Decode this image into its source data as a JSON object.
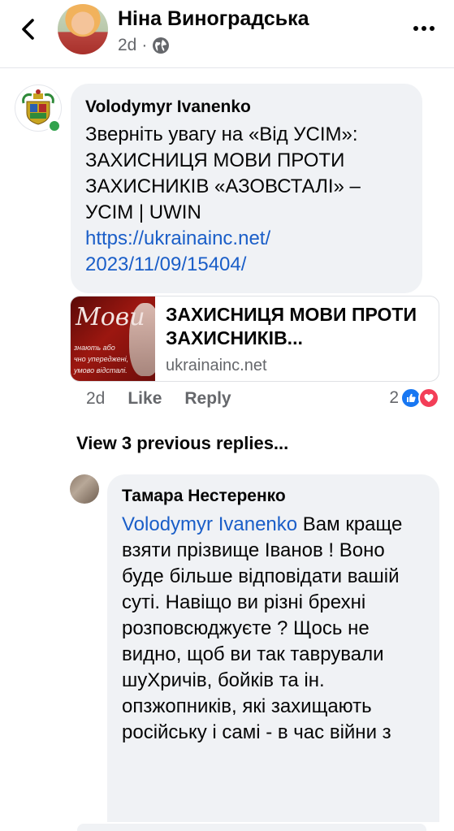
{
  "header": {
    "name": "Ніна Виноградська",
    "time": "2d",
    "separator": "·"
  },
  "comment1": {
    "author": "Volodymyr Ivanenko",
    "text": "Зверніть увагу на «Від УСІМ»: ЗАХИСНИЦЯ МОВИ ПРОТИ ЗАХИСНИКІВ «АЗОВСТАЛІ» – УСІМ | UWIN",
    "link": "https://ukrainainc.net/ 2023/11/09/15404/",
    "preview": {
      "title": "ЗАХИСНИЦЯ МОВИ ПРОТИ ЗАХИСНИКІВ...",
      "domain": "ukrainainc.net",
      "image_word": "Мови",
      "image_line1": "знають або",
      "image_line2": "чно упереджені,",
      "image_line3": "умово відсталі."
    },
    "time": "2d",
    "like_label": "Like",
    "reply_label": "Reply",
    "reaction_count": "2"
  },
  "view_previous": "View 3 previous replies...",
  "comment2": {
    "author": "Тамара Нестеренко",
    "mention": "Volodymyr Ivanenko",
    "text": " Вам краще взяти прізвище Іванов ! Воно буде більше відповідати вашій суті. Навіщо ви різні брехні розповсюджуєте ? Щось не видно, щоб ви так таврували шуХричів, бойків та ін. опзжопників, які захищають російську і самі - в час війни з"
  },
  "colors": {
    "link": "#1a5ec8",
    "bubble": "#f0f2f5",
    "online": "#31a24c",
    "like": "#1877f2",
    "love": "#f33e58"
  },
  "icons": {
    "back": "chevron-left-icon",
    "more": "more-dots-icon",
    "audience": "globe-icon",
    "like_reaction": "thumbs-up-icon",
    "love_reaction": "heart-icon"
  }
}
